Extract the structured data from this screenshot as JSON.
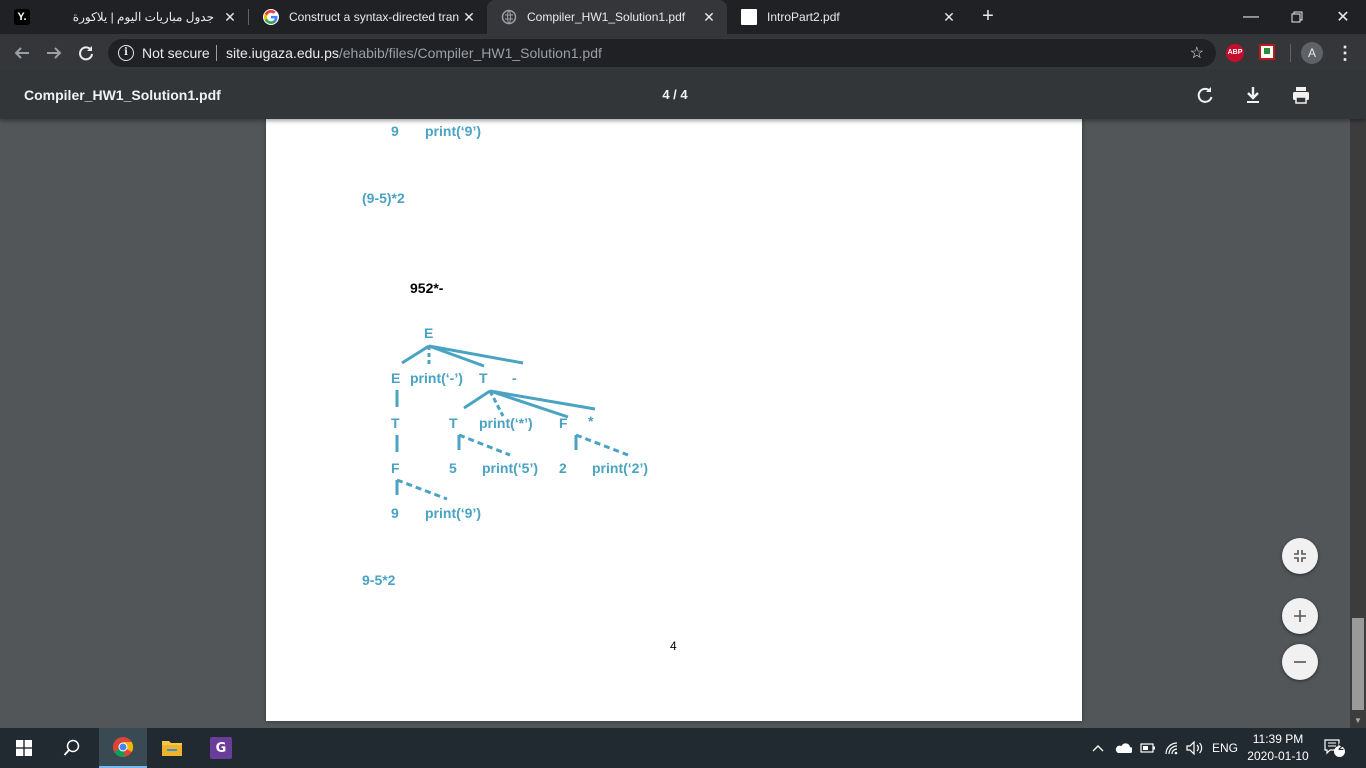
{
  "browser": {
    "tabs": [
      {
        "title": "جدول مباريات اليوم | يلاكورة",
        "favicon": "Y."
      },
      {
        "title": "Construct a syntax-directed trans",
        "favicon": "G"
      },
      {
        "title": "Compiler_HW1_Solution1.pdf",
        "favicon": ""
      },
      {
        "title": "IntroPart2.pdf",
        "favicon": ""
      }
    ],
    "security_label": "Not secure",
    "url_host": "site.iugaza.edu.ps",
    "url_path": "/ehabib/files/Compiler_HW1_Solution1.pdf",
    "abp_label": "ABP",
    "profile_initial": "A"
  },
  "pdf": {
    "filename": "Compiler_HW1_Solution1.pdf",
    "page_indicator": "4 / 4",
    "content": {
      "top_leaf_num": "9",
      "top_leaf_print": "print(‘9’)",
      "expr1": "(9-5)*2",
      "postfix": "952*-",
      "tree": {
        "root": "E",
        "l1_e": "E",
        "l1_print": "print(‘-’)",
        "l1_t": "T",
        "l1_minus": "-",
        "l2_t_left": "T",
        "l2_t": "T",
        "l2_print": "print(‘*’)",
        "l2_f": "F",
        "l2_star": "*",
        "l3_f": "F",
        "l3_5": "5",
        "l3_print5": "print(‘5’)",
        "l3_2": "2",
        "l3_print2": "print(‘2’)",
        "l4_9": "9",
        "l4_print9": "print(‘9’)"
      },
      "expr2": "9-5*2",
      "page_number": "4"
    }
  },
  "taskbar": {
    "language": "ENG",
    "time": "11:39 PM",
    "date": "2020-01-10",
    "notification_count": "2"
  },
  "colors": {
    "tree_text": "#4aa3c2"
  }
}
